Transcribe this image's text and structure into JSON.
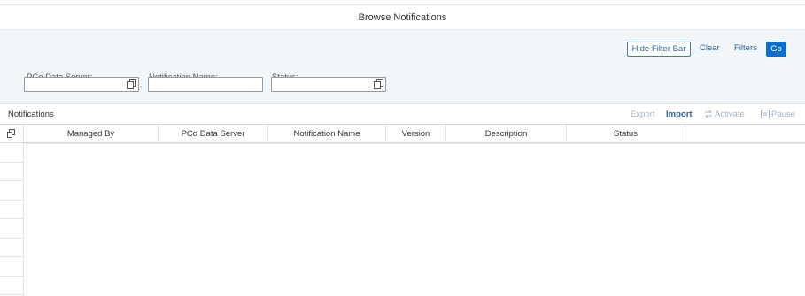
{
  "page": {
    "title": "Browse Notifications"
  },
  "filter_bar": {
    "hide_button": "Hide Filter Bar",
    "clear_button": "Clear",
    "filters_button": "Filters",
    "go_button": "Go",
    "fields": [
      {
        "label": "PCo Data Server:",
        "value": "",
        "icon": "value-help-icon"
      },
      {
        "label": "Notification Name:",
        "value": ""
      },
      {
        "label": "Status:",
        "value": "",
        "icon": "value-help-icon"
      }
    ]
  },
  "table": {
    "title": "Notifications",
    "toolbar": {
      "export": "Export",
      "import": "Import",
      "activate": "Activate",
      "pause": "Pause"
    },
    "columns": [
      "Managed By",
      "PCo Data Server",
      "Notification Name",
      "Version",
      "Description",
      "Status"
    ],
    "rows": []
  },
  "colors": {
    "accent": "#0a6ed1",
    "link": "#2b6596",
    "disabled": "#a4b6c8",
    "filterbar_bg": "#f0f6f9"
  }
}
